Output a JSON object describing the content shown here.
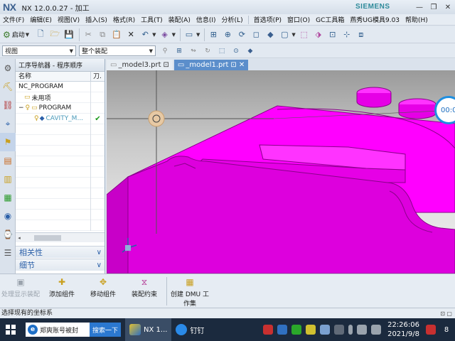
{
  "window": {
    "logo": "NX",
    "title": "NX 12.0.0.27 - 加工",
    "brand": "SIEMENS",
    "controls": [
      "—",
      "❐",
      "✕"
    ]
  },
  "menu": {
    "items": [
      "文件(F)",
      "编辑(E)",
      "视图(V)",
      "插入(S)",
      "格式(R)",
      "工具(T)",
      "装配(A)",
      "信息(I)",
      "分析(L)",
      "首选项(P)",
      "窗口(O)",
      "GC工具箱",
      "燕秀UG模具9.03",
      "帮助(H)"
    ]
  },
  "toolbar1": {
    "start_label": "启动"
  },
  "toolbar2": {
    "filter_value": "视图",
    "assembly_value": "整个装配"
  },
  "navigator": {
    "title": "工序导航器 - 程序顺序",
    "col_name": "名称",
    "col_tool": "刀.",
    "rows": [
      {
        "label": "NC_PROGRAM",
        "status": ""
      },
      {
        "label": "未用项",
        "status": ""
      },
      {
        "label": "PROGRAM",
        "status": ""
      },
      {
        "label": "CAVITY_M...",
        "status": "✔"
      }
    ],
    "section_related": "相关性",
    "section_details": "细节"
  },
  "tabs": [
    {
      "label": "_model3.prt",
      "active": false
    },
    {
      "label": "_model1.prt",
      "active": true
    }
  ],
  "viewport": {
    "timer": "00:0"
  },
  "commands": [
    {
      "label": "处理显示装配",
      "enabled": false
    },
    {
      "label": "添加组件",
      "enabled": true
    },
    {
      "label": "移动组件",
      "enabled": true
    },
    {
      "label": "装配约束",
      "enabled": true
    },
    {
      "label": "创建 DMU 工作集",
      "enabled": true
    }
  ],
  "status": {
    "message": "选择现有的坐标系"
  },
  "taskbar": {
    "ie_text": "郑爽账号被封",
    "ie_go": "搜索一下",
    "nx_app": "NX 1...",
    "dingtalk": "钉钉",
    "time": "22:26:06",
    "date": "2021/9/8",
    "notifications": "8"
  },
  "colors": {
    "part": "#ff00ff",
    "accent": "#5b8ecb",
    "check": "#1a9a1a"
  }
}
